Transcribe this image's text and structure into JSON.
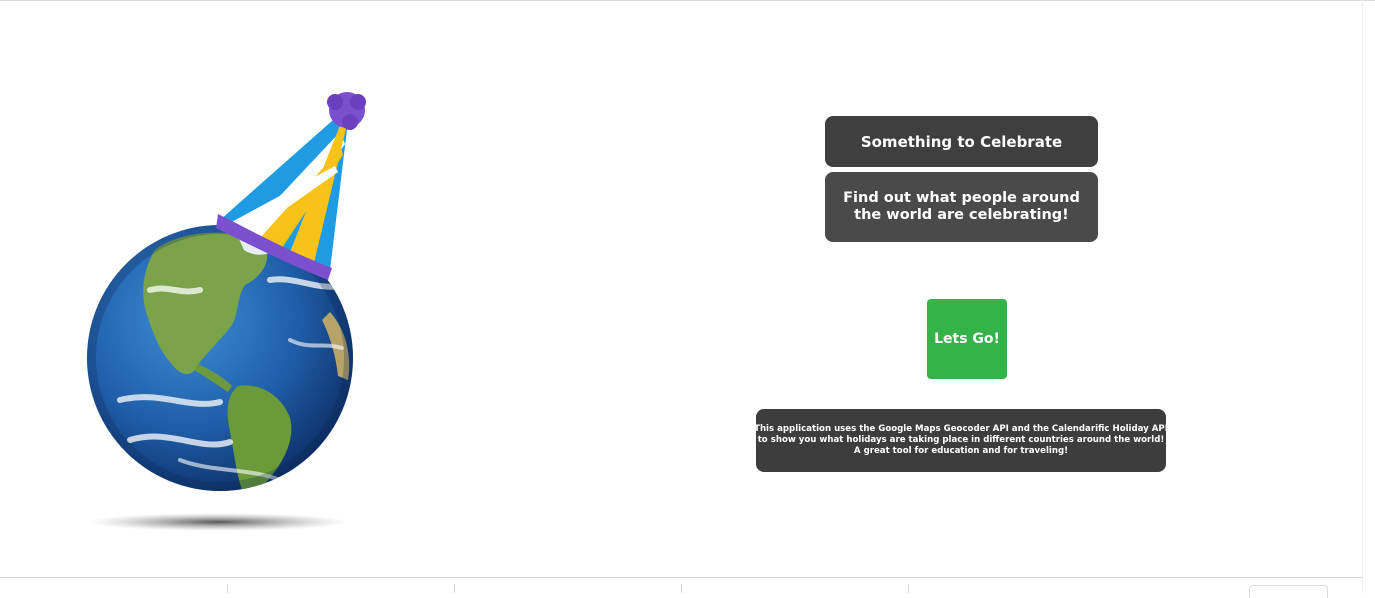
{
  "hero": {
    "image_label": "Earth globe wearing a party hat",
    "colors": {
      "hat_blue": "#1e9be3",
      "hat_yellow": "#f7c21a",
      "hat_white": "#ffffff",
      "hat_trim": "#7b4fcf",
      "ocean": "#1f5da8",
      "land": "#6d9a3e"
    }
  },
  "header": {
    "title": "Something to Celebrate",
    "subtitle": "Find out what people around the world are celebrating!"
  },
  "actions": {
    "go_label": "Lets Go!",
    "go_color": "#34b34a"
  },
  "about": {
    "lines": [
      "This application uses the Google Maps Geocoder API and the Calendarific Holiday API",
      "to show you what holidays are taking place in different countries around the world!",
      "A great tool for education and for traveling!"
    ]
  },
  "theme": {
    "card_dark": "#3f3f3f",
    "card_mid": "#4a4a4a",
    "text_light": "#ffffff"
  }
}
